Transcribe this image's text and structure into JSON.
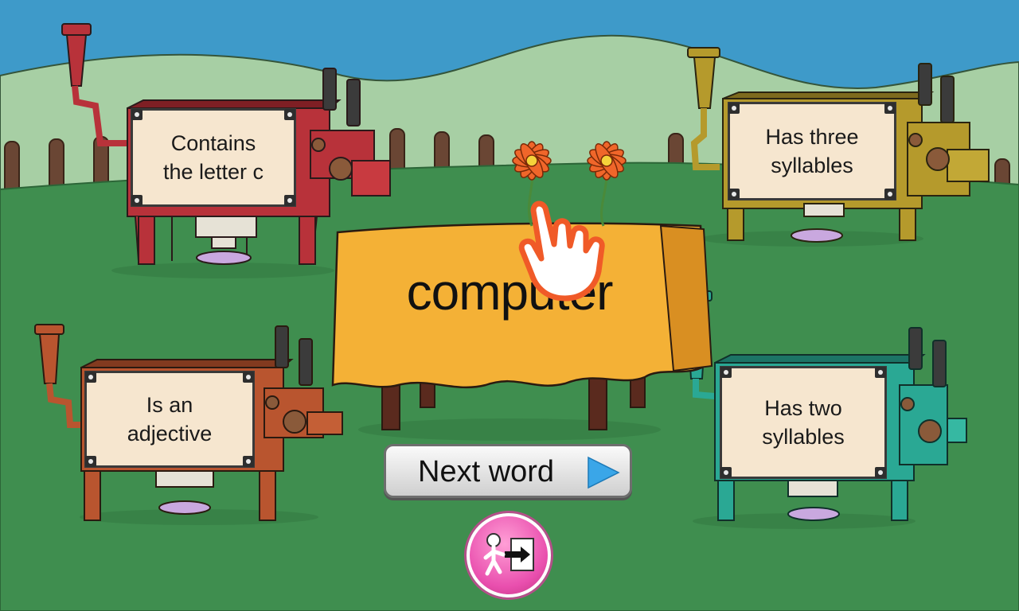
{
  "current_word": "computer",
  "next_button": {
    "label": "Next word"
  },
  "exit_button": {
    "icon": "exit-door-icon"
  },
  "machines": [
    {
      "id": "red",
      "label": "Contains\nthe letter c",
      "color": "#b8323a"
    },
    {
      "id": "olive",
      "label": "Has three\nsyllables",
      "color": "#b59a2c"
    },
    {
      "id": "rust",
      "label": "Is an\nadjective",
      "color": "#b9552f"
    },
    {
      "id": "teal",
      "label": "Has two\nsyllables",
      "color": "#2aa894"
    }
  ],
  "flowers": {
    "count": 2,
    "icon": "orange-flower-icon"
  },
  "tutorial_hint": {
    "icon": "pointing-hand-icon"
  },
  "colors": {
    "sky": "#3e9ac9",
    "hill": "#a7cfa4",
    "grass": "#3f8e4f",
    "table": "#f4b136",
    "fence": "#6a4634"
  }
}
